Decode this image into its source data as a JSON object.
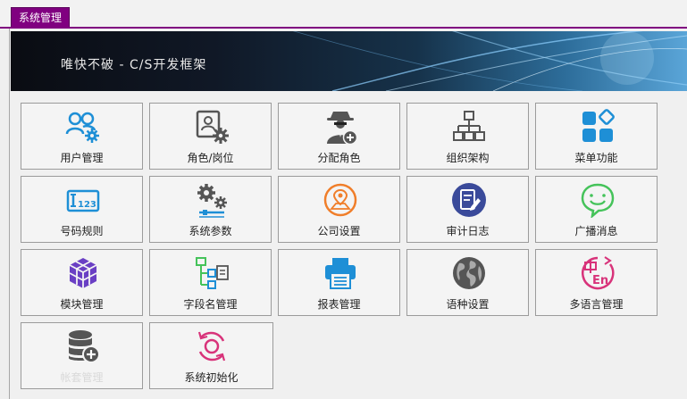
{
  "tab": {
    "label": "系统管理"
  },
  "banner": {
    "title": "唯快不破 - C/S开发框架"
  },
  "colors": {
    "accent": "#800080",
    "blue": "#1e8fd6",
    "orange": "#f07e2a",
    "green": "#45c35a",
    "pink": "#d8337a",
    "dark": "#555555"
  },
  "tiles": [
    {
      "label": "用户管理",
      "icon": "users-gear-icon"
    },
    {
      "label": "角色/岗位",
      "icon": "role-card-gear-icon"
    },
    {
      "label": "分配角色",
      "icon": "agent-add-icon"
    },
    {
      "label": "组织架构",
      "icon": "org-chart-icon"
    },
    {
      "label": "菜单功能",
      "icon": "menu-blocks-icon"
    },
    {
      "label": "号码规则",
      "icon": "number-rule-icon"
    },
    {
      "label": "系统参数",
      "icon": "gears-sliders-icon"
    },
    {
      "label": "公司设置",
      "icon": "company-location-icon"
    },
    {
      "label": "审计日志",
      "icon": "audit-log-icon"
    },
    {
      "label": "广播消息",
      "icon": "chat-message-icon"
    },
    {
      "label": "模块管理",
      "icon": "cube-module-icon"
    },
    {
      "label": "字段名管理",
      "icon": "field-tree-icon"
    },
    {
      "label": "报表管理",
      "icon": "printer-report-icon"
    },
    {
      "label": "语种设置",
      "icon": "globe-icon"
    },
    {
      "label": "多语言管理",
      "icon": "chinese-english-icon"
    },
    {
      "label": "帐套管理",
      "icon": "database-add-icon"
    },
    {
      "label": "系统初始化",
      "icon": "refresh-cycle-icon"
    }
  ]
}
